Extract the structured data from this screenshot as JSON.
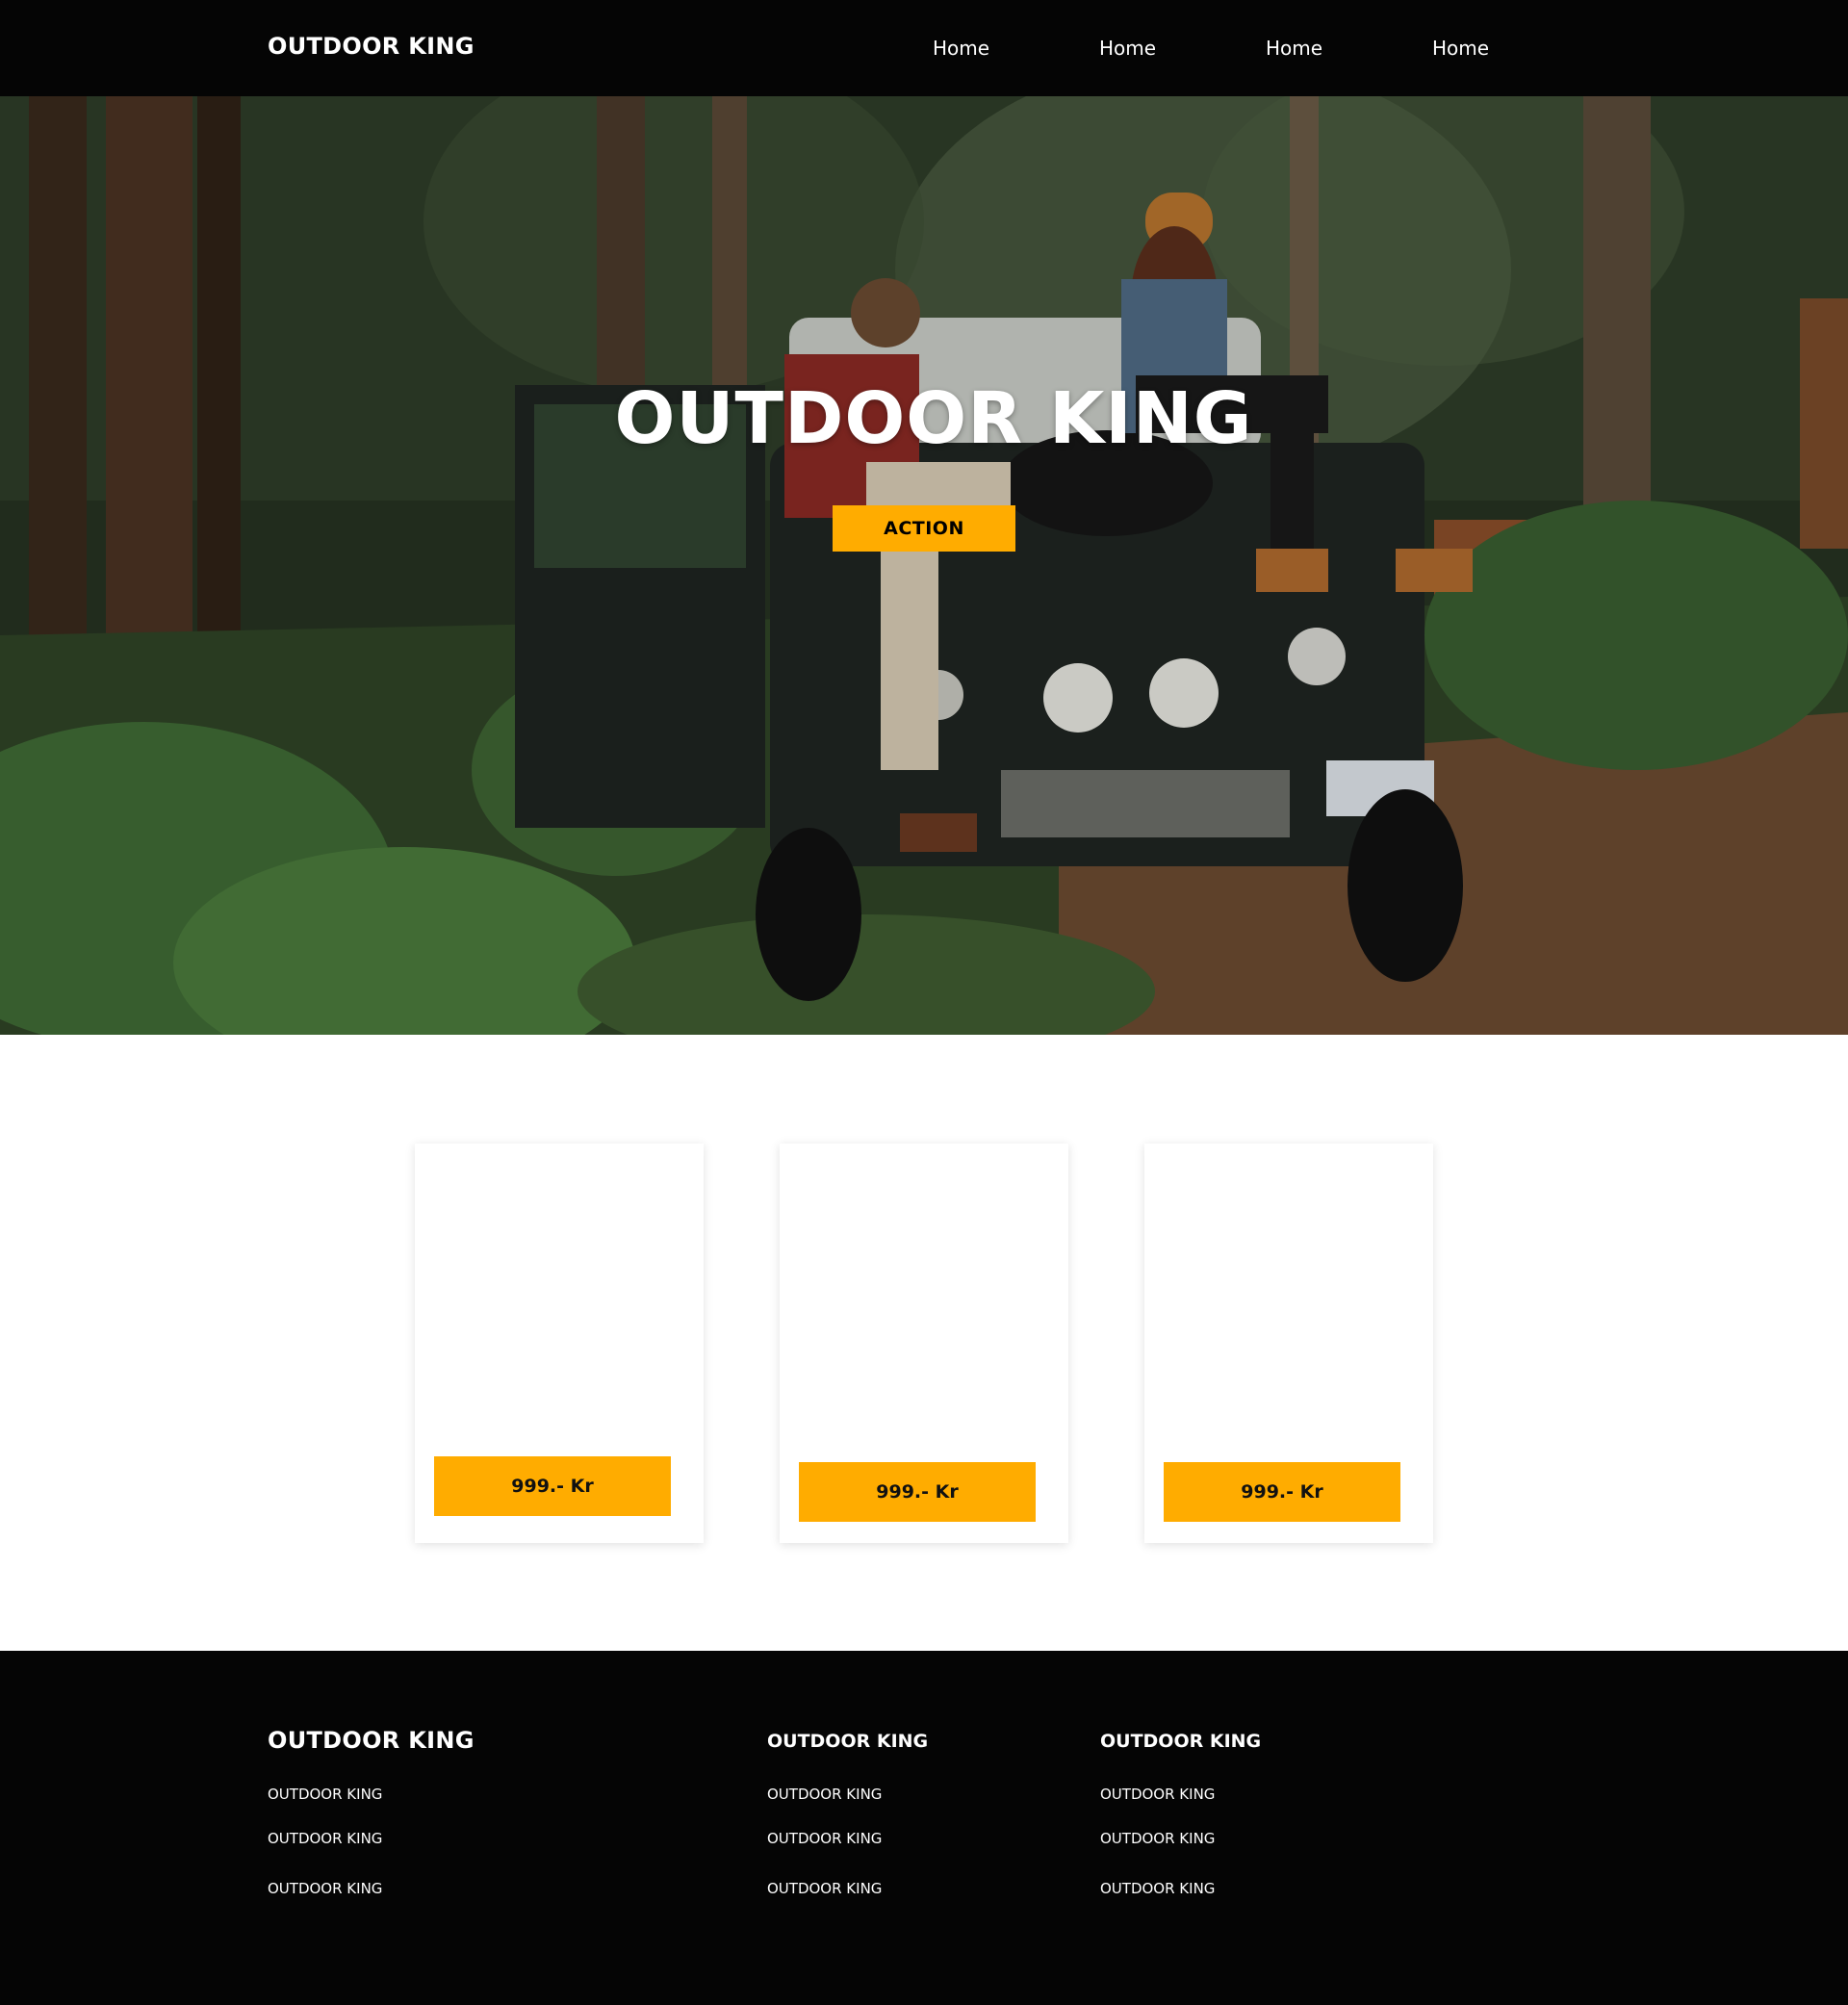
{
  "navbar": {
    "brand": "OUTDOOR KING",
    "links": [
      "Home",
      "Home",
      "Home",
      "Home"
    ]
  },
  "hero": {
    "title": "OUTDOOR KING",
    "action_label": "ACTION",
    "image": "forest-jeep-photo"
  },
  "products": [
    {
      "price": "999.- Kr"
    },
    {
      "price": "999.- Kr"
    },
    {
      "price": "999.- Kr"
    }
  ],
  "footer": {
    "brand": "OUTDOOR KING",
    "col1_links": [
      "OUTDOOR KING",
      "OUTDOOR KING",
      "OUTDOOR KING"
    ],
    "col2": {
      "heading": "OUTDOOR KING",
      "links": [
        "OUTDOOR KING",
        "OUTDOOR KING",
        "OUTDOOR KING"
      ]
    },
    "col3": {
      "heading": "OUTDOOR KING",
      "links": [
        "OUTDOOR KING",
        "OUTDOOR KING",
        "OUTDOOR KING"
      ]
    }
  },
  "colors": {
    "accent": "#ffac00",
    "dark": "#050505",
    "background": "#ffffff"
  }
}
